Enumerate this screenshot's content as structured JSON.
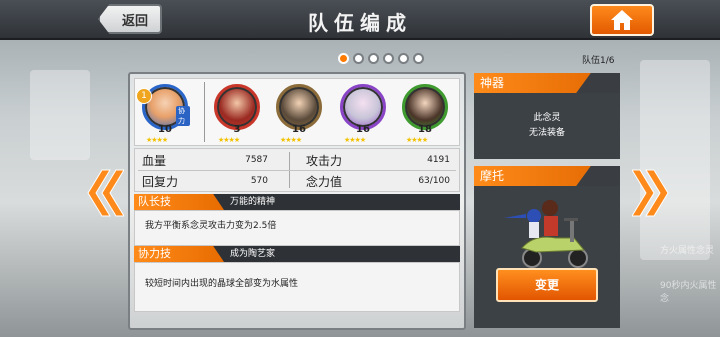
{
  "header": {
    "back_label": "返回",
    "title": "队伍编成",
    "home_icon": "home-icon"
  },
  "pagination": {
    "team_indicator": "队伍1/6",
    "dot_count": 6,
    "active_index": 0
  },
  "members": [
    {
      "level": "10",
      "element_color": "#2a66c9",
      "badge": "1",
      "coop_tag": "协力",
      "stars": "★★★★"
    },
    {
      "level": "3",
      "element_color": "#c9362a",
      "badge": "",
      "coop_tag": "",
      "stars": "★★★★"
    },
    {
      "level": "16",
      "element_color": "#8b6b3a",
      "badge": "",
      "coop_tag": "",
      "stars": "★★★★"
    },
    {
      "level": "16",
      "element_color": "#8a45c7",
      "badge": "",
      "coop_tag": "",
      "stars": "★★★★"
    },
    {
      "level": "18",
      "element_color": "#3f9a2f",
      "badge": "",
      "coop_tag": "",
      "stars": "★★★★"
    }
  ],
  "stats": {
    "hp_label": "血量",
    "hp_value": "7587",
    "attack_label": "攻击力",
    "attack_value": "4191",
    "recovery_label": "回复力",
    "recovery_value": "570",
    "mana_label": "念力值",
    "mana_value": "63/100"
  },
  "leader_skill": {
    "tag": "队长技",
    "name": "万能的精神",
    "desc": "我方平衡系念灵攻击力变为2.5倍"
  },
  "coop_skill": {
    "tag": "协力技",
    "name": "成为陶艺家",
    "desc": "较短时间内出现的晶球全部变为水属性"
  },
  "artifact": {
    "title": "神器",
    "line1": "此念灵",
    "line2": "无法装备"
  },
  "motorcycle": {
    "title": "摩托",
    "change_label": "变更"
  },
  "background_texts": {
    "right1": "方火属性念灵",
    "right2": "90秒内火属性念"
  },
  "colors": {
    "accent": "#ff7a00",
    "panel_dark": "#3c4146"
  }
}
